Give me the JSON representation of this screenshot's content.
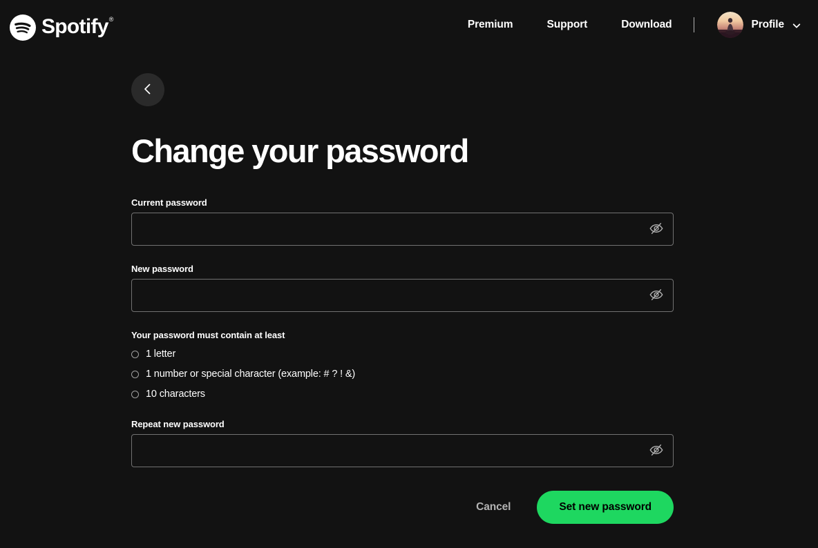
{
  "brand": {
    "name": "Spotify",
    "registered_mark": "®",
    "logo_icon": "spotify-logo-icon",
    "green": "#1ED760",
    "background": "#121212"
  },
  "header": {
    "nav_links": [
      {
        "label": "Premium",
        "name": "nav-link-premium"
      },
      {
        "label": "Support",
        "name": "nav-link-support"
      },
      {
        "label": "Download",
        "name": "nav-link-download"
      }
    ],
    "divider": "|",
    "profile": {
      "label": "Profile",
      "avatar_alt": "user-avatar",
      "chevron_icon": "chevron-down-icon"
    }
  },
  "main": {
    "back_button_icon": "chevron-left-icon",
    "title": "Change your password"
  },
  "form": {
    "fields": [
      {
        "label": "Current password",
        "value": "",
        "placeholder": "",
        "name": "current-password-input",
        "toggle_icon": "eye-off-icon"
      },
      {
        "label": "New password",
        "value": "",
        "placeholder": "",
        "name": "new-password-input",
        "toggle_icon": "eye-off-icon"
      },
      {
        "label": "Repeat new password",
        "value": "",
        "placeholder": "",
        "name": "repeat-new-password-input",
        "toggle_icon": "eye-off-icon"
      }
    ],
    "requirements": {
      "title": "Your password must contain at least",
      "items": [
        "1 letter",
        "1 number or special character (example: # ? ! &)",
        "10 characters"
      ]
    },
    "actions": {
      "cancel_label": "Cancel",
      "submit_label": "Set new password"
    }
  }
}
